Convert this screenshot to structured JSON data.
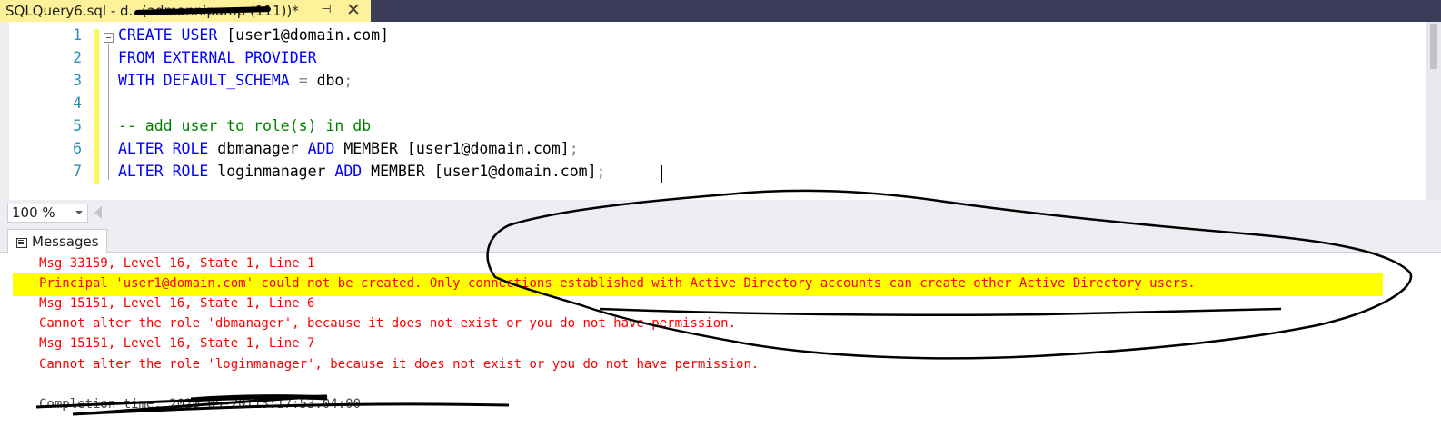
{
  "tab": {
    "title": "SQLQuery6.sql - d...(admannipamp (111))*",
    "pin_icon": "pin-icon",
    "close_icon": "close-icon"
  },
  "editor": {
    "line_numbers": [
      "1",
      "2",
      "3",
      "4",
      "5",
      "6",
      "7"
    ],
    "lines": [
      {
        "parts": [
          [
            "kw",
            "CREATE USER "
          ],
          [
            "n",
            "[user1@domain.com]"
          ]
        ]
      },
      {
        "parts": [
          [
            "kw",
            "FROM EXTERNAL PROVIDER"
          ]
        ]
      },
      {
        "parts": [
          [
            "kw",
            "WITH DEFAULT_SCHEMA "
          ],
          [
            "gr",
            "= "
          ],
          [
            "n",
            "dbo"
          ],
          [
            "gr",
            ";"
          ]
        ]
      },
      {
        "parts": []
      },
      {
        "parts": [
          [
            "cm",
            "-- add user to role(s) in db"
          ]
        ]
      },
      {
        "parts": [
          [
            "kw",
            "ALTER ROLE "
          ],
          [
            "n",
            "dbmanager "
          ],
          [
            "kw",
            "ADD "
          ],
          [
            "n",
            "MEMBER [user1@domain.com]"
          ],
          [
            "gr",
            ";"
          ]
        ]
      },
      {
        "parts": [
          [
            "kw",
            "ALTER ROLE "
          ],
          [
            "n",
            "loginmanager "
          ],
          [
            "kw",
            "ADD "
          ],
          [
            "n",
            "MEMBER [user1@domain.com]"
          ],
          [
            "gr",
            ";"
          ]
        ]
      }
    ]
  },
  "zoom": {
    "value": "100 %"
  },
  "results": {
    "tab_label": "Messages",
    "messages": [
      "Msg 33159, Level 16, State 1, Line 1",
      "Principal 'user1@domain.com' could not be created. Only connections established with Active Directory accounts can create other Active Directory users.",
      "Msg 15151, Level 16, State 1, Line 6",
      "Cannot alter the role 'dbmanager', because it does not exist or you do not have permission.",
      "Msg 15151, Level 16, State 1, Line 7",
      "Cannot alter the role 'loginmanager', because it does not exist or you do not have permission."
    ],
    "completion": "Completion time: 2020-05-20T13:17:53.04:00"
  },
  "colors": {
    "keyword": "#0000ff",
    "comment": "#008000",
    "error": "#ff0000",
    "highlight": "#ffff00",
    "tab_active": "#fdf29a"
  }
}
